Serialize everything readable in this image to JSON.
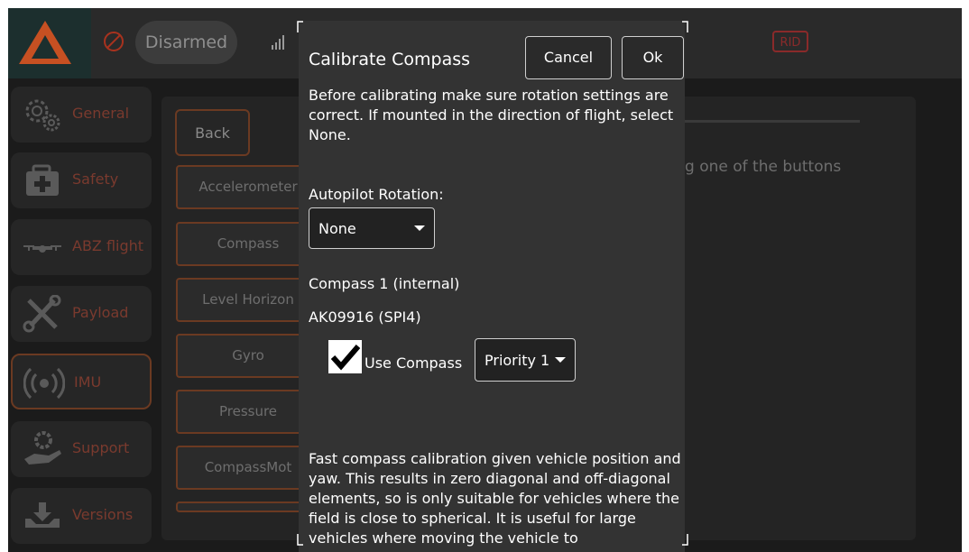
{
  "status": {
    "armed_state": "Disarmed",
    "rid_label": "RID"
  },
  "nav": {
    "items": [
      {
        "label": "General",
        "icon": "gears-icon"
      },
      {
        "label": "Safety",
        "icon": "first-aid-icon"
      },
      {
        "label": "ABZ flight",
        "icon": "drone-icon"
      },
      {
        "label": "Payload",
        "icon": "tools-icon"
      },
      {
        "label": "IMU",
        "icon": "broadcast-icon"
      },
      {
        "label": "Support",
        "icon": "support-hand-icon"
      },
      {
        "label": "Versions",
        "icon": "download-tray-icon"
      }
    ],
    "active": "IMU"
  },
  "calibration": {
    "back_label": "Back",
    "buttons": [
      "Accelerometer",
      "Compass",
      "Level Horizon",
      "Gyro",
      "Pressure",
      "CompassMot"
    ],
    "hint_text": "g one of the buttons"
  },
  "dialog": {
    "title": "Calibrate Compass",
    "cancel_label": "Cancel",
    "ok_label": "Ok",
    "intro": "Before calibrating make sure rotation settings are correct. If mounted in the direction of flight, select None.",
    "rotation_label": "Autopilot Rotation:",
    "rotation_value": "None",
    "compass_name": "Compass 1 (internal)",
    "compass_id": "AK09916 (SPI4)",
    "use_compass_label": "Use Compass",
    "use_compass_checked": true,
    "priority_value": "Priority 1",
    "fast_cal_text": "Fast compass calibration given vehicle position and yaw. This results in zero diagonal and off-diagonal elements, so is only suitable for vehicles where the field is close to spherical. It is useful for large vehicles where moving the vehicle to"
  },
  "colors": {
    "accent": "#6b3a22",
    "logo_orange": "#d9592a",
    "dialog_bg": "#333333"
  }
}
